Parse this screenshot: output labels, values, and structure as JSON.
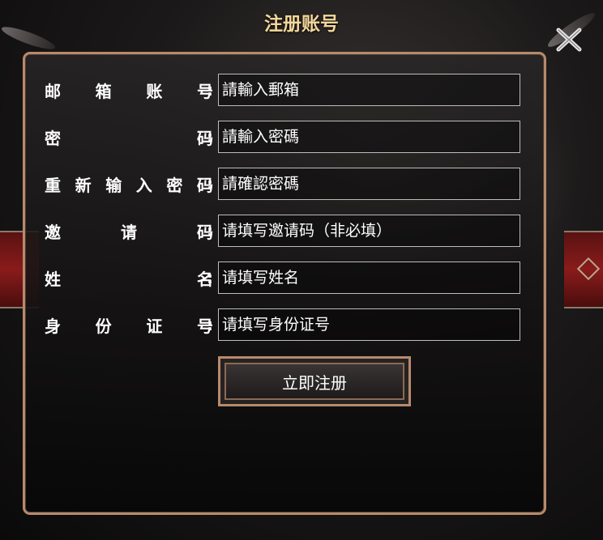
{
  "dialog": {
    "title": "注册账号",
    "close_icon": "close-x-icon"
  },
  "form": {
    "fields": [
      {
        "label_chars": [
          "邮",
          "箱",
          "账",
          "号"
        ],
        "colon": ":",
        "placeholder": "請輸入郵箱"
      },
      {
        "label_chars": [
          "密",
          "码"
        ],
        "colon": ":",
        "placeholder": "請輸入密碼"
      },
      {
        "label_chars": [
          "重",
          "新",
          "输",
          "入",
          "密",
          "码"
        ],
        "colon": ":",
        "placeholder": "請確認密碼"
      },
      {
        "label_chars": [
          "邀",
          "请",
          "码"
        ],
        "colon": ":",
        "placeholder": "请填写邀请码（非必填）"
      },
      {
        "label_chars": [
          "姓",
          "名"
        ],
        "colon": ":",
        "placeholder": "请填写姓名"
      },
      {
        "label_chars": [
          "身",
          "份",
          "证",
          "号"
        ],
        "colon": ":",
        "placeholder": "请填写身份证号"
      }
    ],
    "submit_label": "立即注册"
  },
  "colors": {
    "title": "#f3d79a",
    "panel_border": "#b78a6c",
    "side_band": "#8a1b1b"
  }
}
